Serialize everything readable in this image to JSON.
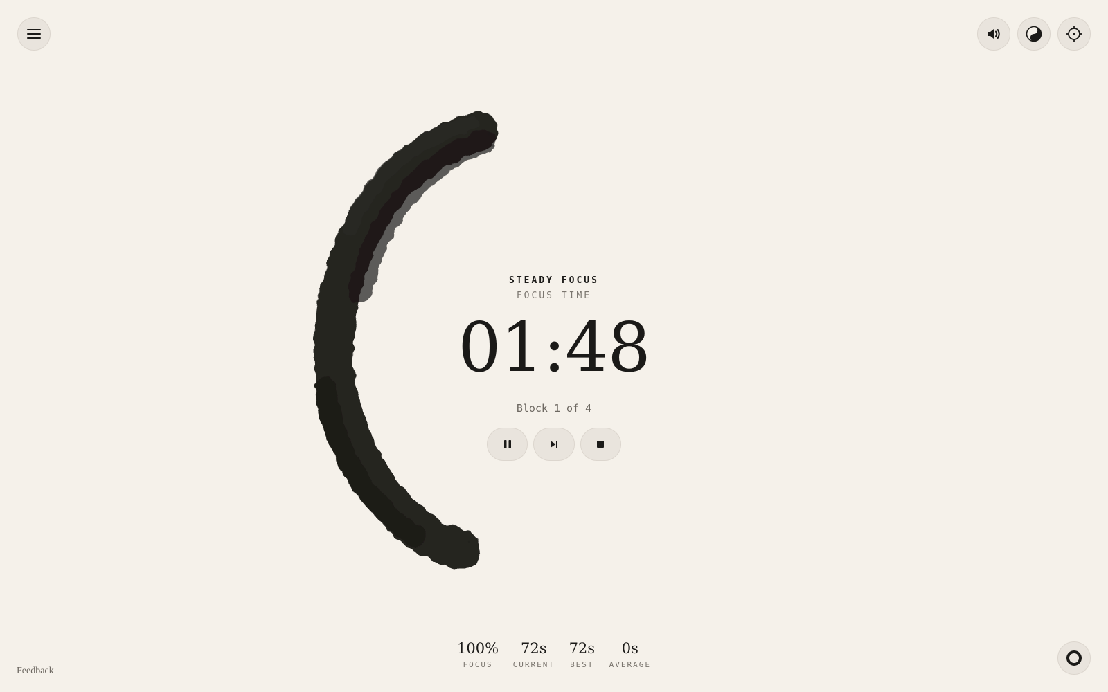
{
  "header": {
    "menu_icon": "hamburger-menu-icon",
    "sound_icon": "speaker-icon",
    "theme_icon": "yin-yang-icon",
    "focus_icon": "crosshair-icon"
  },
  "session": {
    "mode_title": "STEADY FOCUS",
    "mode_subtitle": "FOCUS TIME",
    "timer": "01:48",
    "block_info": "Block 1 of 4",
    "progress_fraction": 0.5
  },
  "controls": {
    "pause_icon": "pause-icon",
    "skip_icon": "skip-forward-icon",
    "stop_icon": "stop-icon"
  },
  "stats": [
    {
      "value": "100%",
      "label": "FOCUS"
    },
    {
      "value": "72s",
      "label": "CURRENT"
    },
    {
      "value": "72s",
      "label": "BEST"
    },
    {
      "value": "0s",
      "label": "AVERAGE"
    }
  ],
  "footer": {
    "feedback_label": "Feedback",
    "ring_icon": "circle-ring-icon"
  },
  "colors": {
    "background": "#f5f1ea",
    "ink": "#1b1a18",
    "button_bg": "#e9e4dd",
    "muted_text": "#7b766f"
  }
}
